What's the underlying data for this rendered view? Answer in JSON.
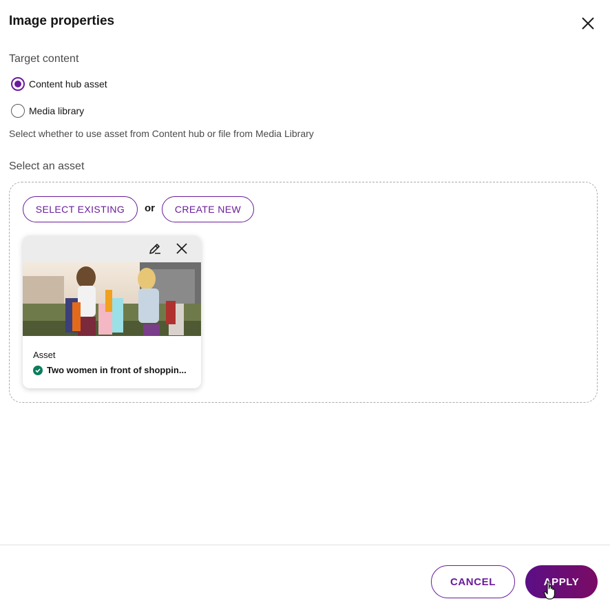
{
  "dialog": {
    "title": "Image properties",
    "close_icon": "close-icon"
  },
  "target_content": {
    "label": "Target content",
    "options": [
      {
        "label": "Content hub asset",
        "selected": true
      },
      {
        "label": "Media library",
        "selected": false
      }
    ],
    "helper_text": "Select whether to use asset from Content hub or file from Media Library"
  },
  "asset_section": {
    "label": "Select an asset",
    "select_existing_label": "SELECT EXISTING",
    "or_label": "or",
    "create_new_label": "CREATE NEW",
    "card": {
      "caption": "Asset",
      "name": "Two women in front of shoppin...",
      "status": "check-circle-icon",
      "edit_icon": "edit-icon",
      "remove_icon": "close-icon"
    }
  },
  "footer": {
    "cancel_label": "CANCEL",
    "apply_label": "APPLY"
  },
  "colors": {
    "accent": "#6a1b9a",
    "success": "#0a7d5c"
  }
}
